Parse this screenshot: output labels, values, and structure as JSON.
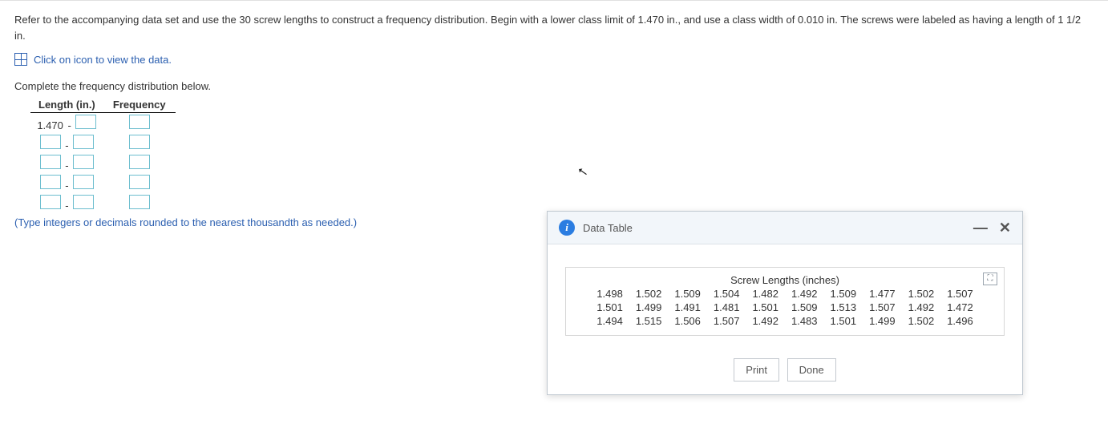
{
  "problem_text": "Refer to the accompanying data set and use the 30 screw lengths to construct a frequency distribution. Begin with a lower class limit of 1.470 in., and use a class width of 0.010 in. The screws were labeled as having a length of 1 1/2 in.",
  "view_data_link": "Click on icon to view the data.",
  "complete_heading": "Complete the frequency distribution below.",
  "freq_table": {
    "col1": "Length (in.)",
    "col2": "Frequency",
    "first_lower": "1.470"
  },
  "hint": "(Type integers or decimals rounded to the nearest thousandth as needed.)",
  "dialog": {
    "title": "Data Table",
    "data_heading": "Screw Lengths (inches)",
    "print": "Print",
    "done": "Done"
  },
  "chart_data": {
    "type": "table",
    "title": "Screw Lengths (inches)",
    "columns": 10,
    "rows": 3,
    "values": [
      1.498,
      1.502,
      1.509,
      1.504,
      1.482,
      1.492,
      1.509,
      1.477,
      1.502,
      1.507,
      1.501,
      1.499,
      1.491,
      1.481,
      1.501,
      1.509,
      1.513,
      1.507,
      1.492,
      1.472,
      1.494,
      1.515,
      1.506,
      1.507,
      1.492,
      1.483,
      1.501,
      1.499,
      1.502,
      1.496
    ]
  }
}
